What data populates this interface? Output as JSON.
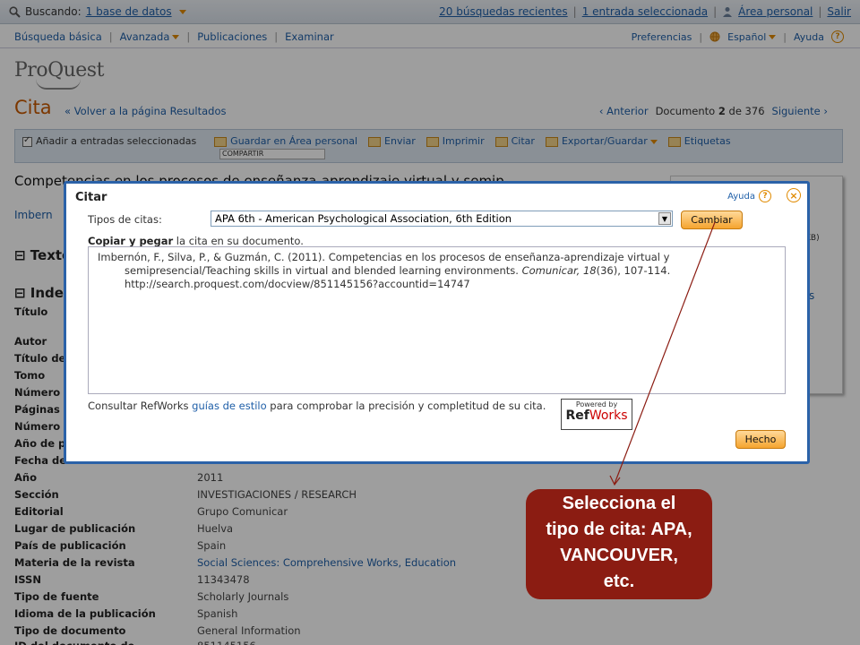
{
  "topbar": {
    "searching_label": "Buscando:",
    "database_link": "1 base de datos",
    "recent_searches": "20 búsquedas recientes",
    "selected_entries": "1 entrada seleccionada",
    "personal_area": "Área personal",
    "logout": "Salir"
  },
  "nav": {
    "basic": "Búsqueda básica",
    "advanced": "Avanzada",
    "publications": "Publicaciones",
    "browse": "Examinar",
    "preferences": "Preferencias",
    "language": "Español",
    "help": "Ayuda"
  },
  "logo": "ProQuest",
  "page": {
    "title": "Cita",
    "back": "« Volver a la página Resultados",
    "prev": "‹ Anterior",
    "doc_word": "Documento",
    "doc_num": "2",
    "of_word": "de 376",
    "next": "Siguiente ›"
  },
  "toolbar": {
    "add_selected": "Añadir a entradas seleccionadas",
    "save_area": "Guardar en Área personal",
    "send": "Enviar",
    "print": "Imprimir",
    "cite": "Citar",
    "export": "Exportar/Guardar",
    "tags": "Etiquetas",
    "share": "COMPARTIR"
  },
  "document": {
    "title_part": "Competencias en los procesos de enseñanza-aprendizaje virtual y semip",
    "authors_part": "Imbern",
    "section_fulltext": "Texto",
    "section_index": "Inde",
    "right_kb": "KB)",
    "right_s": "s"
  },
  "metadata": [
    {
      "k": "Título",
      "v": ""
    },
    {
      "k": "Autor",
      "v": ""
    },
    {
      "k": "Título de",
      "v": ""
    },
    {
      "k": "Tomo",
      "v": ""
    },
    {
      "k": "Número",
      "v": ""
    },
    {
      "k": "Páginas",
      "v": ""
    },
    {
      "k": "Número",
      "v": ""
    },
    {
      "k": "Año de p",
      "v": ""
    },
    {
      "k": "Fecha de",
      "v": ""
    },
    {
      "k": "Año",
      "v": "2011"
    },
    {
      "k": "Sección",
      "v": "INVESTIGACIONES / RESEARCH"
    },
    {
      "k": "Editorial",
      "v": "Grupo Comunicar"
    },
    {
      "k": "Lugar de publicación",
      "v": "Huelva"
    },
    {
      "k": "País de publicación",
      "v": "Spain"
    },
    {
      "k": "Materia de la revista",
      "v": "Social Sciences: Comprehensive Works, Education",
      "link": true
    },
    {
      "k": "ISSN",
      "v": "11343478"
    },
    {
      "k": "Tipo de fuente",
      "v": "Scholarly Journals"
    },
    {
      "k": "Idioma de la publicación",
      "v": "Spanish"
    },
    {
      "k": "Tipo de documento",
      "v": "General Information"
    },
    {
      "k": "ID del documento de",
      "v": "851145156"
    }
  ],
  "modal": {
    "title": "Citar",
    "help": "Ayuda",
    "cite_type_label": "Tipos de citas:",
    "cite_type_value": "APA 6th - American Psychological Association, 6th Edition",
    "change_button": "Cambiar",
    "copy_bold": "Copiar y pegar",
    "copy_rest": " la cita en su documento.",
    "citation_line1": "Imbernón, F., Silva, P., & Guzmán, C. (2011). Competencias en los procesos de enseñanza-aprendizaje virtual y",
    "citation_line2_a": "semipresencial/Teaching skills in virtual and blended learning environments. ",
    "citation_line2_journal": "Comunicar, 18",
    "citation_line2_b": "(36), 107-114.",
    "citation_line3": "http://search.proquest.com/docview/851145156?accountid=14747",
    "refnote_a": "Consultar RefWorks ",
    "refnote_link": "guías de estilo",
    "refnote_b": " para comprobar la precisión y completitud de su cita.",
    "powered_by": "Powered by",
    "refworks_ref": "Ref",
    "refworks_works": "Works",
    "done_button": "Hecho"
  },
  "callout": {
    "line1": "Selecciona el",
    "line2": "tipo de cita: APA,",
    "line3": "VANCOUVER,",
    "line4": "etc."
  },
  "colors": {
    "callout_bg": "#8b1c12",
    "modal_border": "#2b62a8",
    "accent_orange": "#f5a42f",
    "link_blue": "#1f5fa8"
  }
}
